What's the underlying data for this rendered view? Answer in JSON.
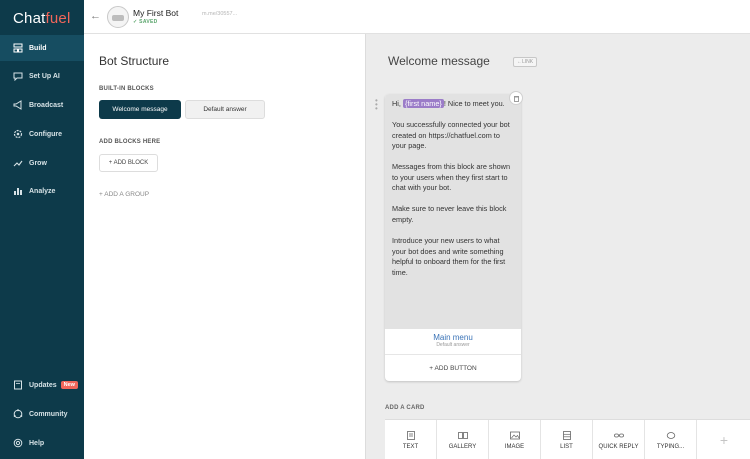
{
  "sidebar": {
    "logo_prefix": "Chat",
    "logo_suffix": "fuel",
    "items": [
      {
        "label": "Build",
        "icon": "build-icon"
      },
      {
        "label": "Set Up AI",
        "icon": "chat-icon"
      },
      {
        "label": "Broadcast",
        "icon": "megaphone-icon"
      },
      {
        "label": "Configure",
        "icon": "gear-icon"
      },
      {
        "label": "Grow",
        "icon": "trend-icon"
      },
      {
        "label": "Analyze",
        "icon": "bar-chart-icon"
      }
    ],
    "bottom_items": [
      {
        "label": "Updates",
        "icon": "book-icon",
        "badge": "New"
      },
      {
        "label": "Community",
        "icon": "community-icon"
      },
      {
        "label": "Help",
        "icon": "help-icon"
      }
    ]
  },
  "topbar": {
    "back_icon": "back-arrow-icon",
    "bot_name": "My First Bot",
    "status": "✓ SAVED",
    "link": "m.me/30557..."
  },
  "structure": {
    "title": "Bot Structure",
    "builtin_label": "BUILT-IN BLOCKS",
    "builtin_blocks": [
      "Welcome message",
      "Default answer"
    ],
    "add_blocks_label": "ADD BLOCKS HERE",
    "add_block_button": "+ ADD BLOCK",
    "add_group_button": "+   ADD A GROUP"
  },
  "editor": {
    "block_title": "Welcome message",
    "link_tag": "LINK",
    "text_card": {
      "greeting_prefix": "Hi,",
      "attribute": "{first name}",
      "greeting_suffix": "! Nice to meet you.",
      "paragraphs": [
        "You successfully connected your bot created on https://chatfuel.com to your page.",
        "Messages from this block are shown to your users when they first start to chat with your bot.",
        "Make sure to never leave this block empty.",
        "Introduce your new users to what your bot does and write something helpful to onboard them for the first time."
      ],
      "button_title": "Main menu",
      "button_subtitle": "Default answer",
      "add_button": "+ ADD BUTTON"
    },
    "add_card_label": "ADD A CARD",
    "card_types": [
      {
        "label": "TEXT",
        "icon": "text-icon"
      },
      {
        "label": "GALLERY",
        "icon": "gallery-icon"
      },
      {
        "label": "IMAGE",
        "icon": "image-icon"
      },
      {
        "label": "LIST",
        "icon": "list-icon"
      },
      {
        "label": "QUICK REPLY",
        "icon": "quick-reply-icon"
      },
      {
        "label": "TYPING...",
        "icon": "typing-icon"
      }
    ],
    "more_cards": "+"
  }
}
